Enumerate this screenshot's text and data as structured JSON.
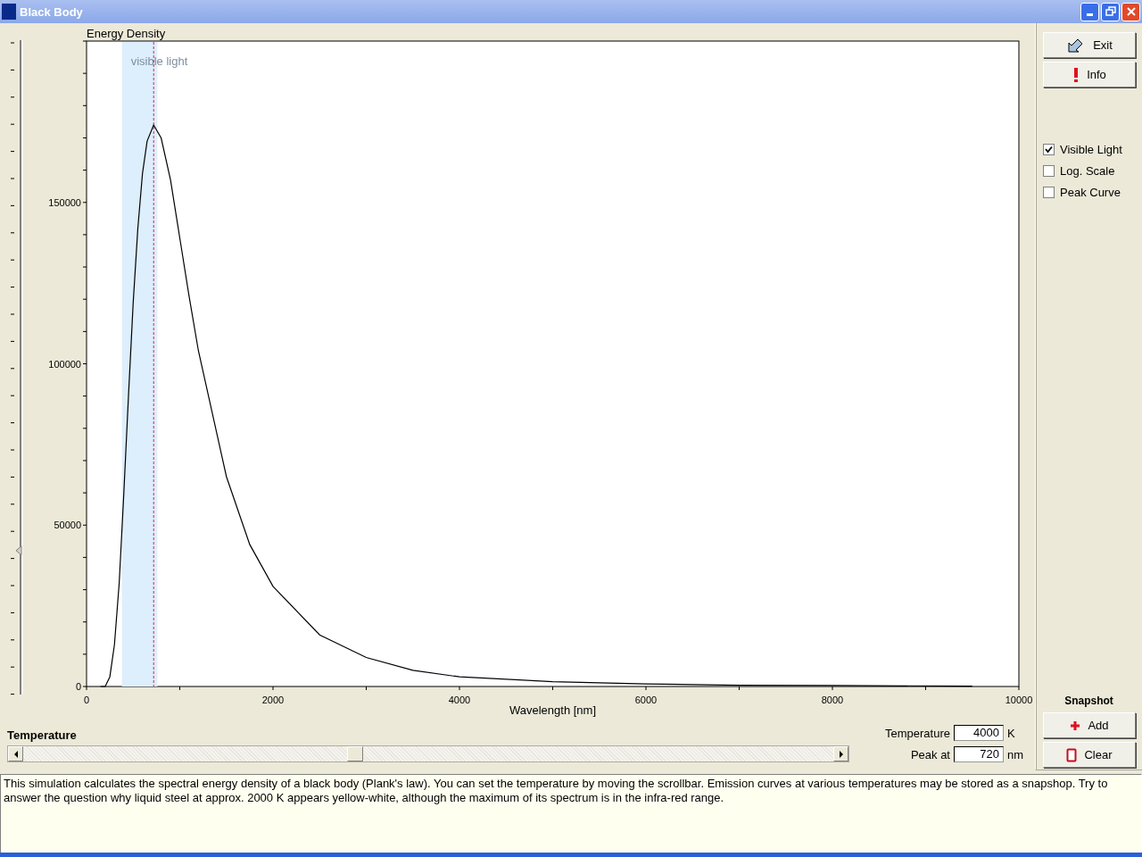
{
  "window": {
    "title": "Black Body"
  },
  "chart": {
    "chart_data": {
      "type": "line",
      "title": "Energy Density",
      "xlabel": "Wavelength [nm]",
      "x": [
        150,
        200,
        250,
        300,
        350,
        400,
        450,
        500,
        550,
        600,
        650,
        720,
        800,
        900,
        1000,
        1100,
        1200,
        1500,
        1750,
        2000,
        2500,
        3000,
        3500,
        4000,
        5000,
        6000,
        7000,
        8000,
        9500
      ],
      "series": [
        {
          "color": "#000000",
          "values": [
            0,
            0,
            3000,
            13000,
            32000,
            60000,
            90000,
            119000,
            142000,
            159000,
            169000,
            174000,
            170000,
            157000,
            139000,
            121000,
            104000,
            65000,
            44000,
            31000,
            16000,
            9000,
            5000,
            3000,
            1500,
            800,
            400,
            300,
            100
          ]
        }
      ],
      "xlim": [
        0,
        10000
      ],
      "ylim": [
        0,
        200000
      ],
      "xticks": [
        0,
        2000,
        4000,
        6000,
        8000,
        10000
      ],
      "yticks": [
        0,
        50000,
        100000,
        150000
      ],
      "bands": [
        {
          "axis": "x",
          "from": 380,
          "to": 760,
          "label": "visible light"
        }
      ],
      "ref_lines": [
        {
          "axis": "x",
          "value": 720
        }
      ]
    }
  },
  "side_slider": {
    "level": 0.22
  },
  "buttons": [
    {
      "label": "Exit"
    },
    {
      "label": "Info"
    }
  ],
  "options": [
    {
      "label": "Visible Light",
      "checked": true
    },
    {
      "label": "Log. Scale",
      "checked": false
    },
    {
      "label": "Peak Curve",
      "checked": false
    }
  ],
  "snapshot": {
    "title": "Snapshot",
    "buttons": [
      {
        "label": "Add"
      },
      {
        "label": "Clear"
      }
    ]
  },
  "temperature_slider": {
    "label": "Temperature",
    "level": 0.4
  },
  "fields": [
    {
      "label": "Temperature",
      "value": "4000",
      "unit": "K"
    },
    {
      "label": "Peak at",
      "value": "720",
      "unit": "nm"
    }
  ],
  "description": "This simulation calculates the spectral energy density of a black body (Plank's law). You can set the temperature by moving the scrollbar. Emission curves at various temperatures may be stored as a snapshop. Try to answer the question why liquid steel at approx. 2000 K appears yellow-white, although the maximum of its spectrum is in the infra-red range."
}
